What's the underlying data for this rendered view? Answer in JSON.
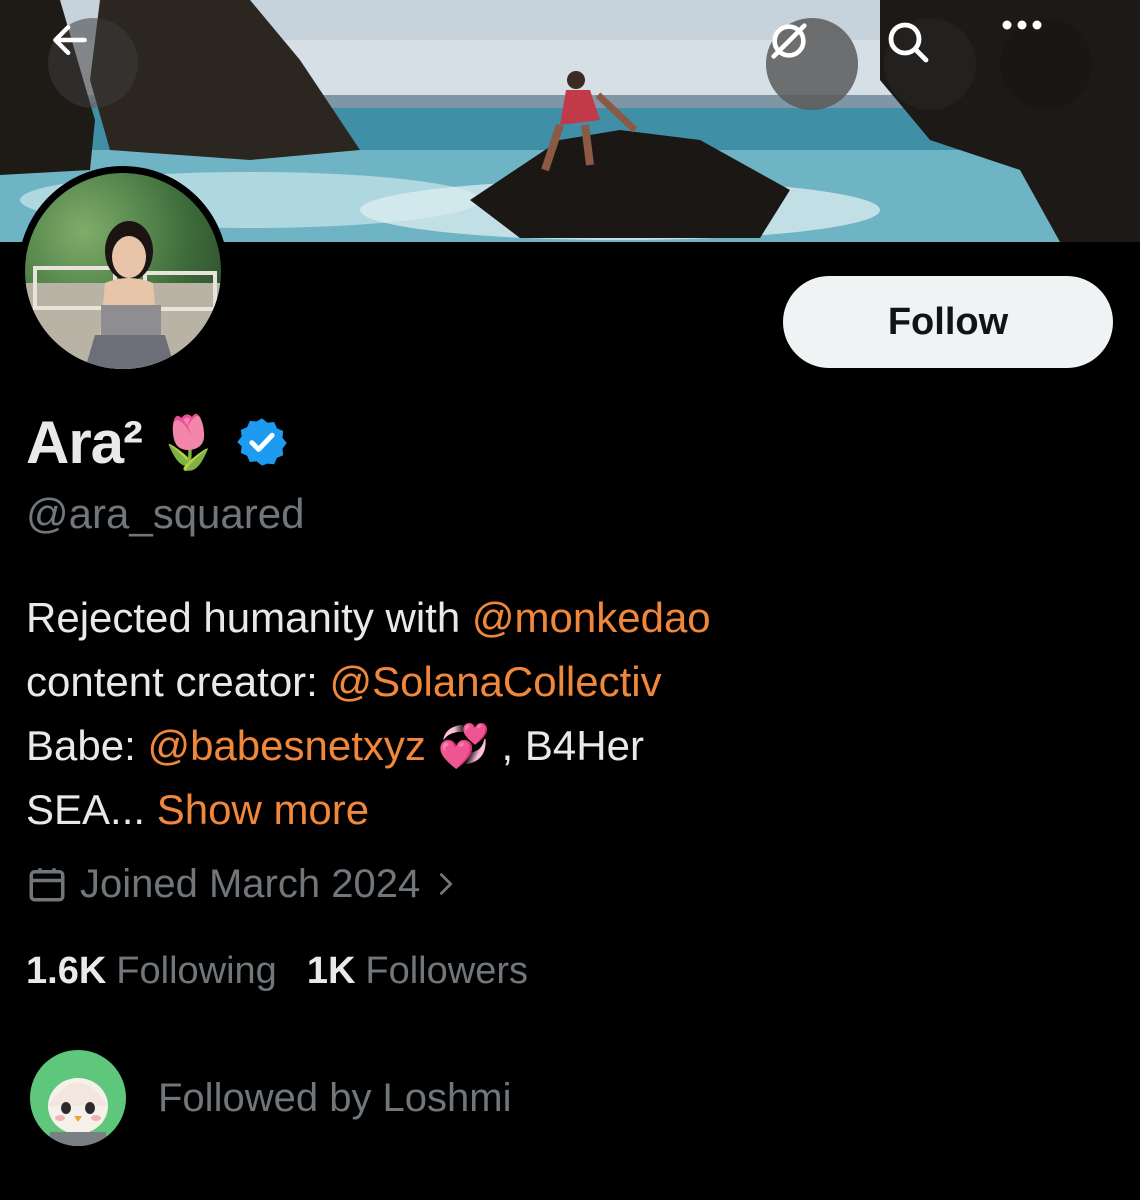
{
  "header": {
    "back_icon": "arrow-left-icon",
    "grok_icon": "grok-icon",
    "search_icon": "search-icon",
    "more_icon": "more-horizontal-icon"
  },
  "profile": {
    "display_name": "Ara²",
    "name_emoji": "🌷",
    "verified": true,
    "verified_color": "#1d9bf0",
    "handle": "@ara_squared",
    "follow_label": "Follow",
    "bio": {
      "line1_text": "Rejected humanity with ",
      "line1_mention": "@monkedao",
      "line2_text": "content creator: ",
      "line2_mention": "@SolanaCollectiv",
      "line3_text": "Babe: ",
      "line3_mention": "@babesnetxyz",
      "line3_emoji": "💞",
      "line3_suffix": " , B4Her",
      "line4_text": "SEA... ",
      "show_more": "Show more"
    },
    "joined": "Joined March 2024",
    "following_count": "1.6K",
    "following_label": "Following",
    "followers_count": "1K",
    "followers_label": "Followers",
    "followed_by": "Followed by Loshmi"
  },
  "colors": {
    "accent": "#f0873a",
    "muted": "#71767b",
    "text": "#e7e9ea",
    "background": "#000000"
  }
}
